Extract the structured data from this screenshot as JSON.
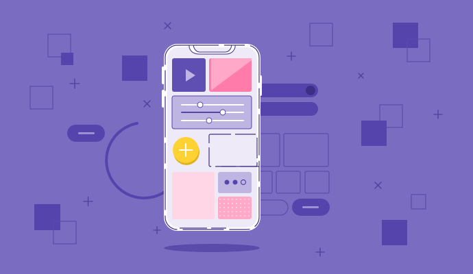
{
  "illustration": {
    "subject": "mobile-ui-design",
    "icons": [
      "play-icon",
      "plus-icon",
      "dots-icon"
    ]
  },
  "colors": {
    "background": "#7a6cc0",
    "deep_purple": "#5644ad",
    "light_outline": "#4d3f9c",
    "phone_frame": "#ffffff",
    "phone_screen": "#eeeaf7",
    "pink": "#ff7ba9",
    "light_pink": "#ffd6e6",
    "lavender": "#bfb5e3",
    "yellow": "#ffd233",
    "shadow": "#5a4bab"
  }
}
